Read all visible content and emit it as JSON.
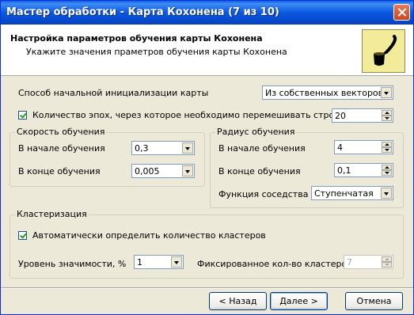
{
  "window": {
    "title": "Мастер обработки - Карта Кохонена (7 из 10)"
  },
  "header": {
    "title": "Настройка параметров обучения карты Кохонена",
    "subtitle": "Укажите значения праметров обучения карты Кохонена",
    "icon": "pipe-icon"
  },
  "init": {
    "label": "Способ начальной инициализации карты",
    "value": "Из собственных векторов"
  },
  "epochs": {
    "label": "Количество эпох, через которое необходимо перемешивать строки",
    "value": "20",
    "checked": true
  },
  "learning_rate": {
    "title": "Скорость обучения",
    "start_label": "В начале обучения",
    "start_value": "0,3",
    "end_label": "В конце обучения",
    "end_value": "0,005"
  },
  "radius": {
    "title": "Радиус обучения",
    "start_label": "В начале обучения",
    "start_value": "4",
    "end_label": "В конце обучения",
    "end_value": "0,1",
    "neighborhood_label": "Функция соседства",
    "neighborhood_value": "Ступенчатая"
  },
  "clustering": {
    "title": "Кластеризация",
    "auto_label": "Автоматически определить количество кластеров",
    "auto_checked": true,
    "significance_label": "Уровень значимости, %",
    "significance_value": "1",
    "fixed_label": "Фиксированное кол-во кластеров",
    "fixed_value": "7"
  },
  "buttons": {
    "back": "< Назад",
    "next": "Далее >",
    "cancel": "Отмена"
  }
}
